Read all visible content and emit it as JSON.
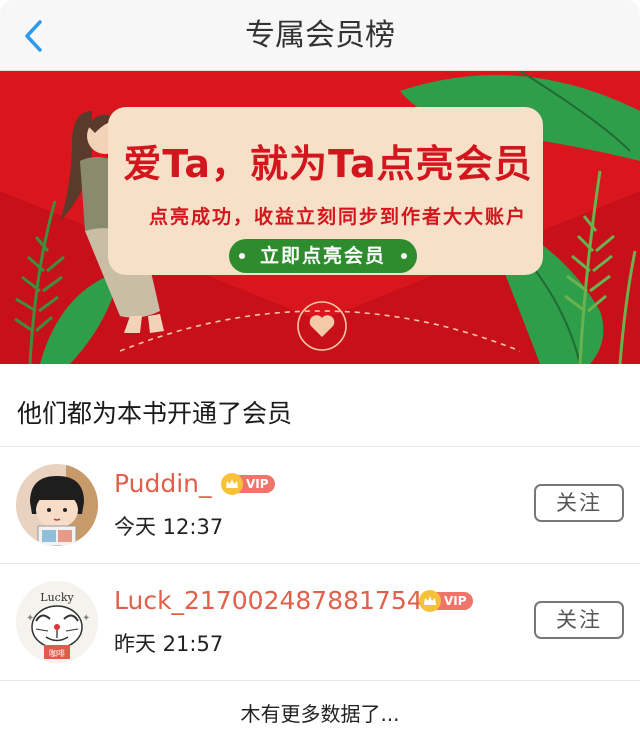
{
  "header": {
    "title": "专属会员榜",
    "back_icon": "chevron-left-icon",
    "accent": "#2d9bf0"
  },
  "banner": {
    "headline": "爱Ta，就为Ta点亮会员",
    "subtitle": "点亮成功，收益立刻同步到作者大大账户",
    "button_label": "立即点亮会员",
    "background": "#d9161e",
    "button_color": "#2e8b2e"
  },
  "section": {
    "title": "他们都为本书开通了会员"
  },
  "members": [
    {
      "name": "Puddin_",
      "badge": "VIP",
      "time": "今天 12:37",
      "follow_label": "关注"
    },
    {
      "name": "Luck_217002487881754",
      "badge": "VIP",
      "time": "昨天 21:57",
      "follow_label": "关注"
    }
  ],
  "footer": {
    "note": "木有更多数据了..."
  },
  "avatar2_text": {
    "top": "Lucky",
    "tag": "咖啡"
  }
}
